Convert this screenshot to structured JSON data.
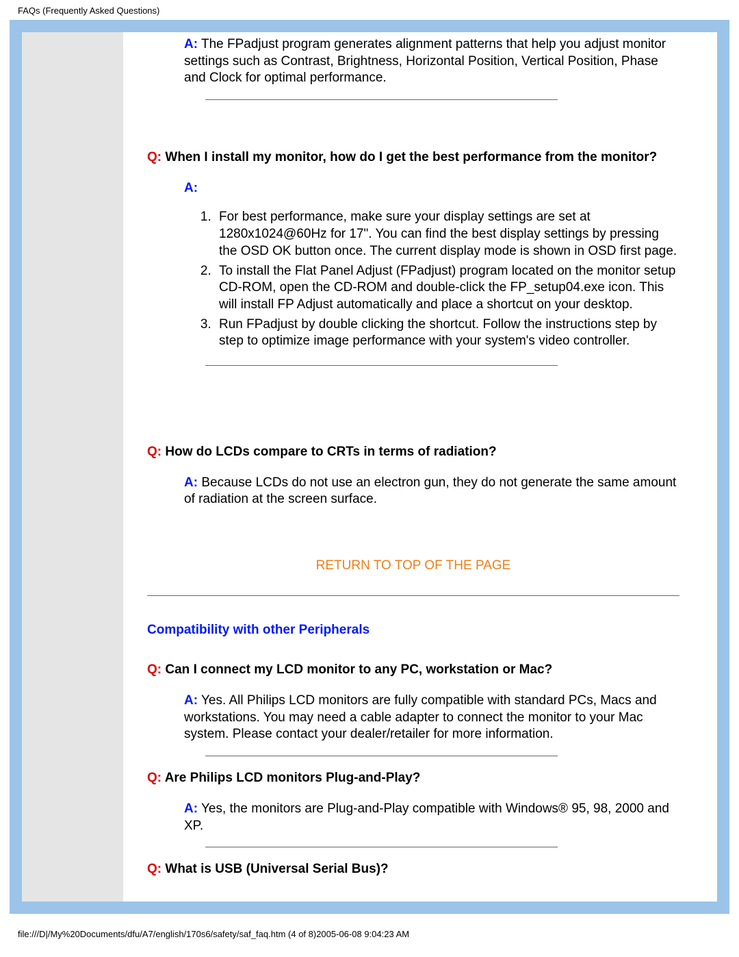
{
  "header": "FAQs (Frequently Asked Questions)",
  "footer": "file:///D|/My%20Documents/dfu/A7/english/170s6/safety/saf_faq.htm (4 of 8)2005-06-08 9:04:23 AM",
  "q_prefix": "Q:",
  "a_prefix": "A:",
  "return_link": "RETURN TO TOP OF THE PAGE",
  "top_answer": "The FPadjust program generates alignment patterns that help you adjust monitor settings such as Contrast, Brightness, Horizontal Position, Vertical Position, Phase and Clock for optimal performance.",
  "q1": "When I install my monitor, how do I get the best performance from the monitor?",
  "q1_list": {
    "i1": "For best performance, make sure your display settings are set at 1280x1024@60Hz for 17\". You can find the best display settings by pressing the OSD OK button once. The current display mode is shown in OSD first page.",
    "i2": "To install the Flat Panel Adjust (FPadjust) program located on the monitor setup CD-ROM, open the CD-ROM and double-click the FP_setup04.exe icon. This will install FP Adjust automatically and place a shortcut on your desktop.",
    "i3": "Run FPadjust by double clicking the shortcut. Follow the instructions step by step to optimize image performance with your system's video controller."
  },
  "q2": "How do LCDs compare to CRTs in terms of radiation?",
  "a2": "Because LCDs do not use an electron gun, they do not generate the same amount of radiation at the screen surface.",
  "section_title": "Compatibility with other Peripherals",
  "q3": "Can I connect my LCD monitor to any PC, workstation or Mac?",
  "a3": "Yes. All Philips LCD monitors are fully compatible with standard PCs, Macs and workstations. You may need a cable adapter to connect the monitor to your Mac system. Please contact your dealer/retailer for more information.",
  "q4": "Are Philips LCD monitors Plug-and-Play?",
  "a4": "Yes, the monitors are Plug-and-Play compatible with Windows® 95, 98, 2000 and XP.",
  "q5": "What is USB (Universal Serial Bus)?"
}
